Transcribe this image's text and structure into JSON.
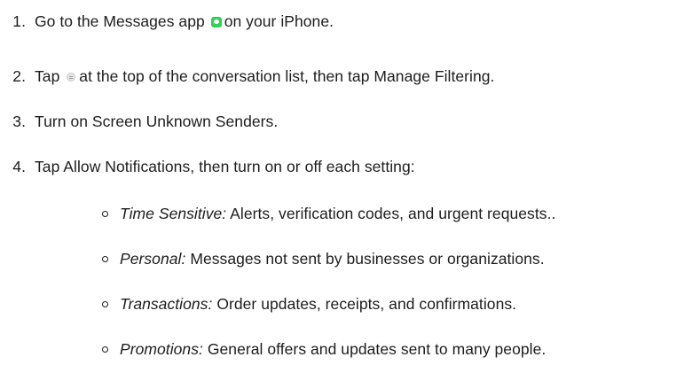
{
  "steps": [
    {
      "number": "1.",
      "before": "Go to the Messages app",
      "icon": "messages-app-icon",
      "after": "on your iPhone."
    },
    {
      "number": "2.",
      "before": "Tap",
      "icon": "filter-icon",
      "after": "at the top of the conversation list, then tap Manage Filtering."
    },
    {
      "number": "3.",
      "text": "Turn on Screen Unknown Senders."
    },
    {
      "number": "4.",
      "text": "Tap Allow Notifications, then turn on or off each setting:"
    }
  ],
  "settings": [
    {
      "label": "Time Sensitive:",
      "description": "Alerts, verification codes, and urgent requests.."
    },
    {
      "label": "Personal:",
      "description": "Messages not sent by businesses or organizations."
    },
    {
      "label": "Transactions:",
      "description": "Order updates, receipts, and confirmations."
    },
    {
      "label": "Promotions:",
      "description": "General offers and updates sent to many people."
    }
  ],
  "colors": {
    "text": "#1d1d1f",
    "messages_icon": "#2fd158",
    "filter_icon": "#e6e6e6"
  }
}
